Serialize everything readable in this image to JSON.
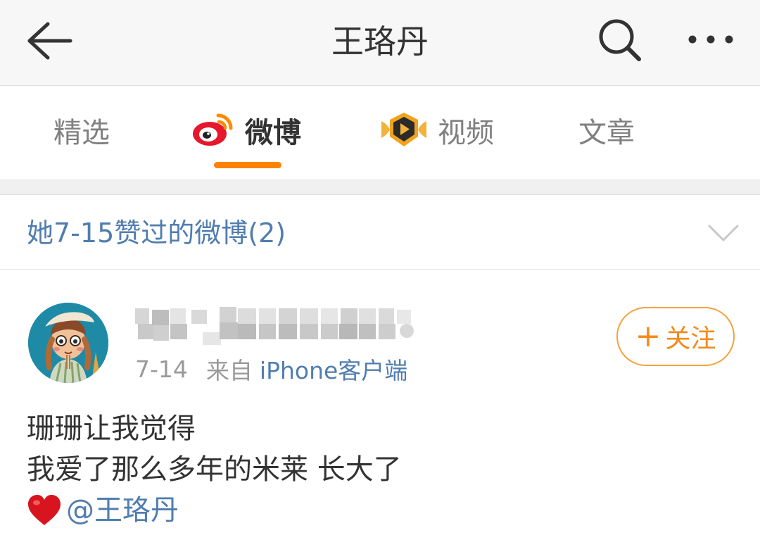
{
  "header": {
    "title": "王珞丹",
    "back_icon": "back-arrow-icon",
    "search_icon": "search-icon",
    "more_icon": "more-dots-icon"
  },
  "tabs": [
    {
      "label": "精选",
      "active": false
    },
    {
      "label": "微博",
      "active": true,
      "icon": "weibo-logo-icon"
    },
    {
      "label": "视频",
      "active": false,
      "icon": "video-badge-icon"
    },
    {
      "label": "文章",
      "active": false
    }
  ],
  "liked_section": {
    "label": "她7-15赞过的微博(2)",
    "chevron_icon": "chevron-down-icon"
  },
  "post": {
    "date": "7-14",
    "from_label": "来自",
    "source": "iPhone客户端",
    "follow_label": "关注",
    "follow_plus": "+",
    "lines": [
      "珊珊让我觉得",
      "我爱了那么多年的米莱 长大了"
    ],
    "mention_emoji": "heart-icon",
    "mention": "@王珞丹"
  },
  "colors": {
    "accent": "#ff8200",
    "link": "#507daf",
    "follow_border": "#f2a33c"
  }
}
